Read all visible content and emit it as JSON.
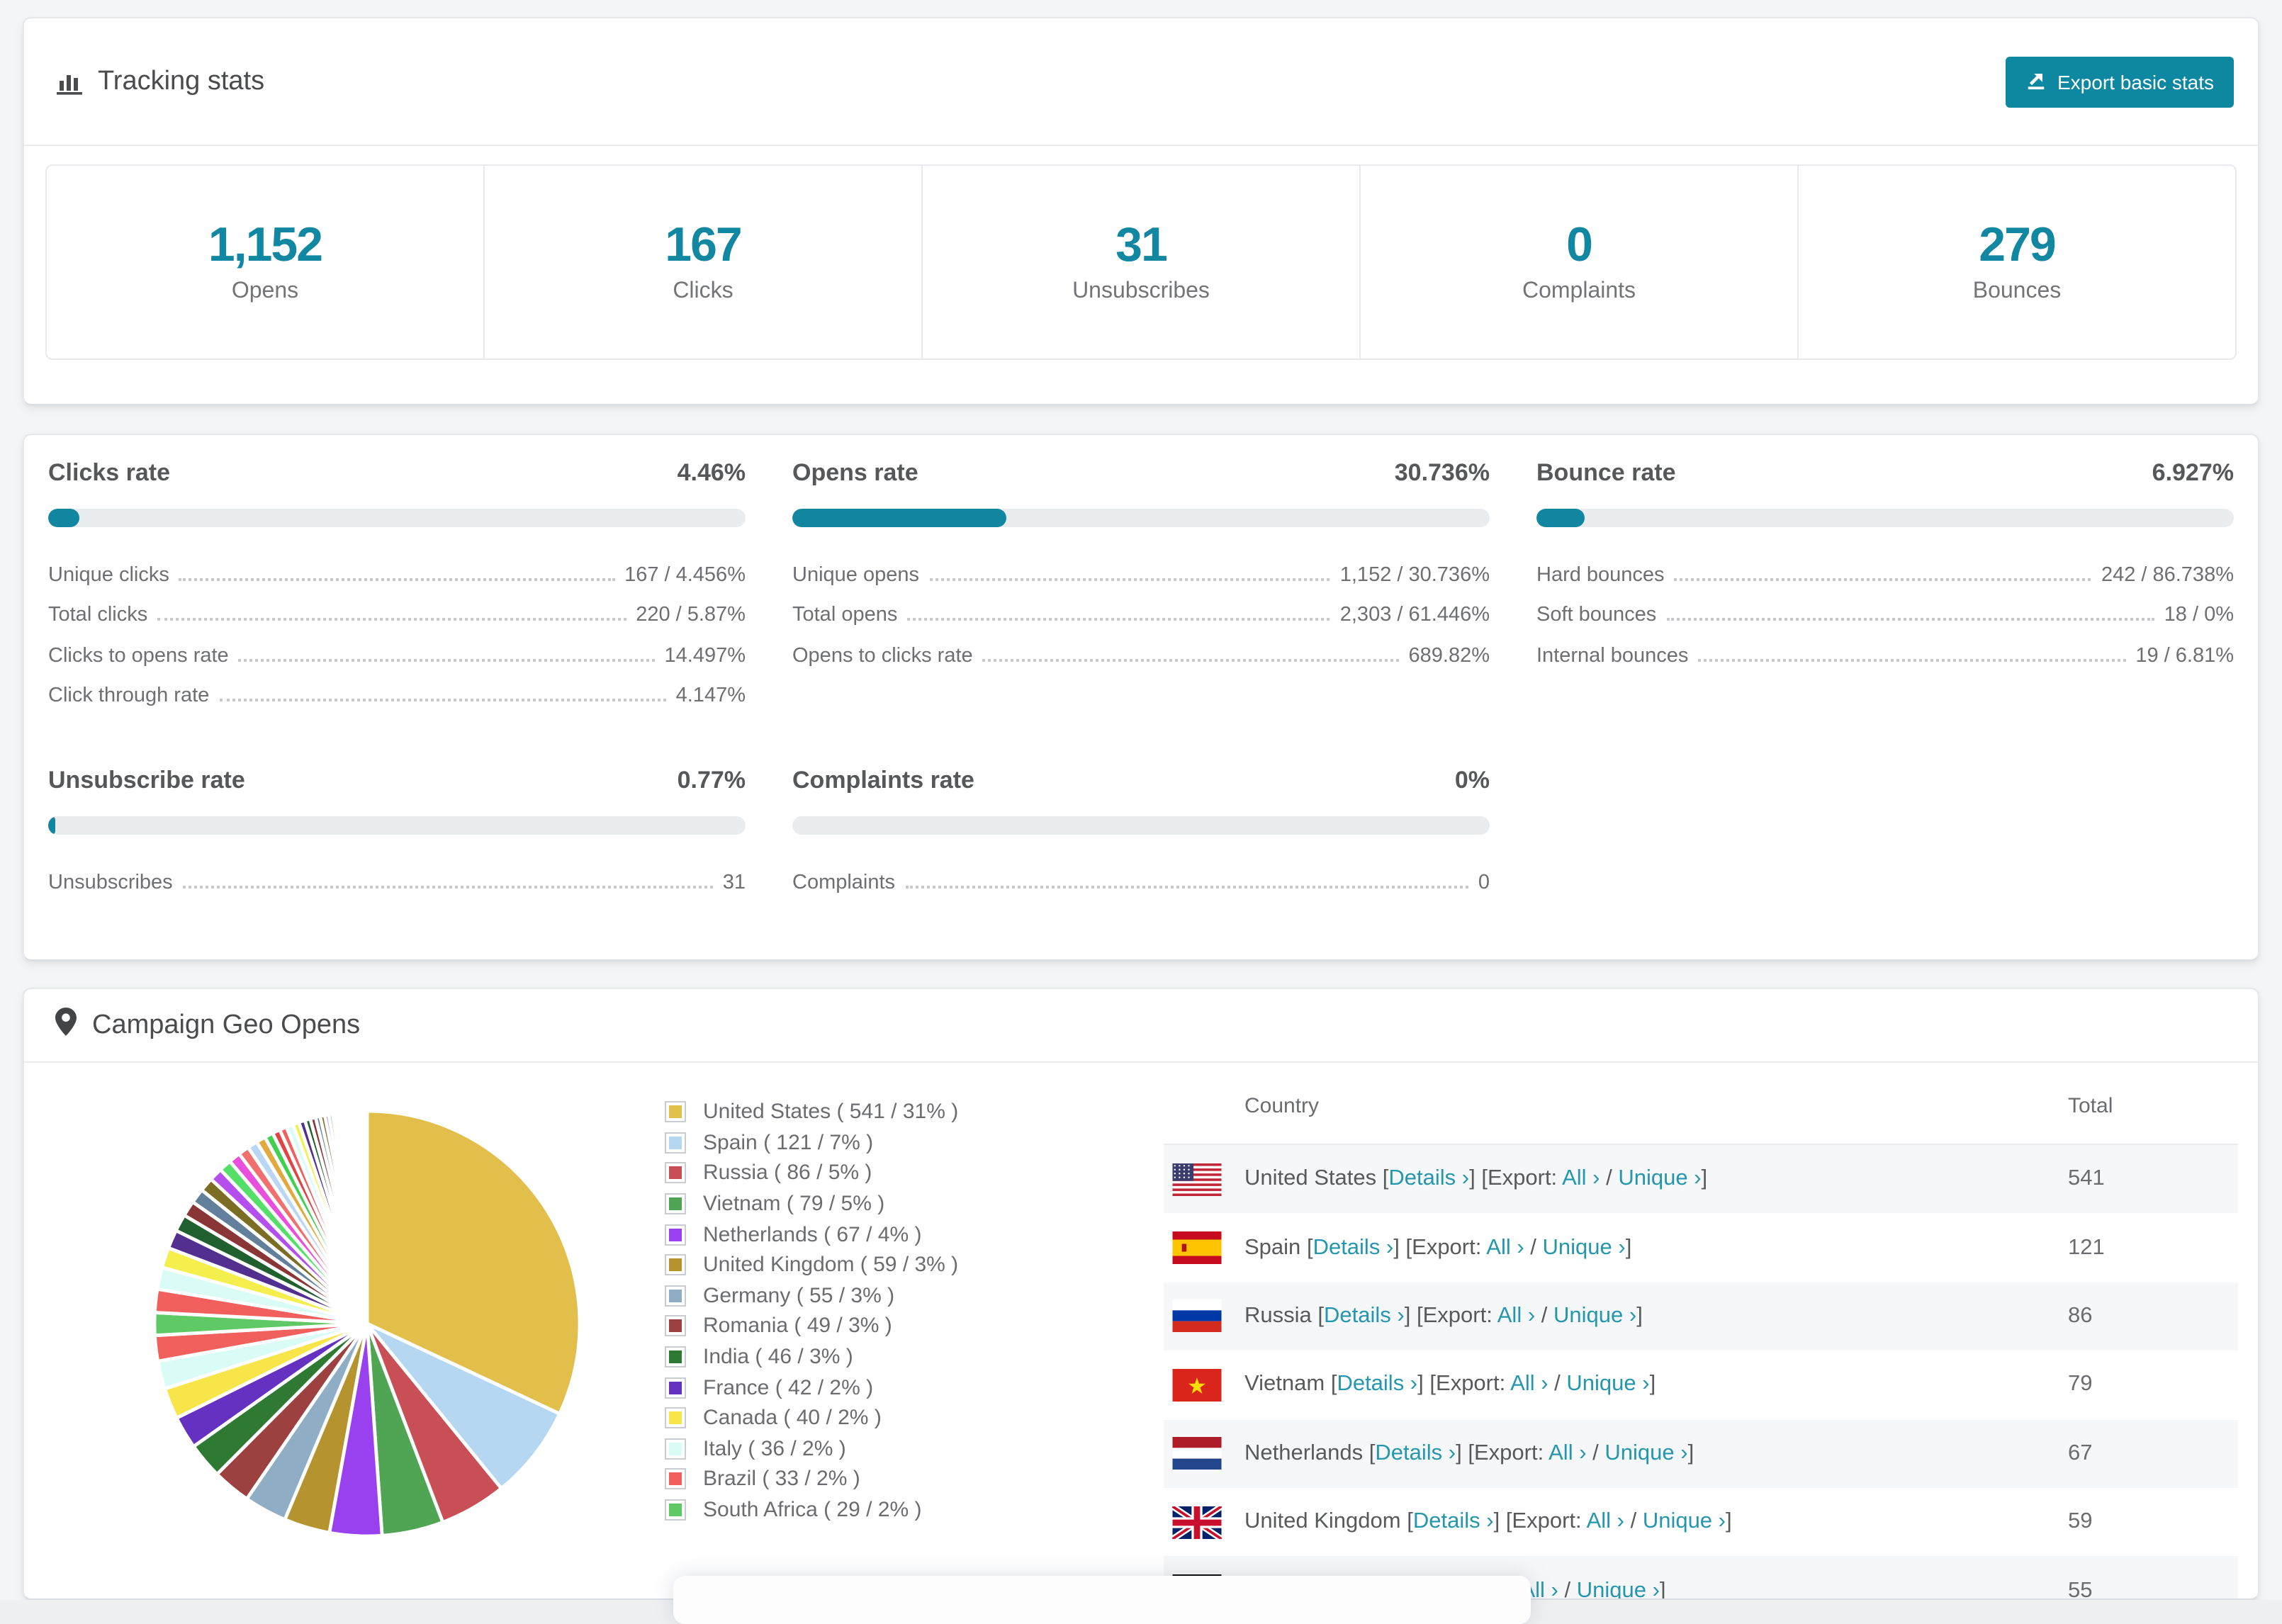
{
  "accent": {
    "teal": "#1186a0",
    "link": "#2496ae"
  },
  "tracking": {
    "title": "Tracking stats",
    "export_button": "Export basic stats",
    "stats": [
      {
        "value": "1,152",
        "label": "Opens"
      },
      {
        "value": "167",
        "label": "Clicks"
      },
      {
        "value": "31",
        "label": "Unsubscribes"
      },
      {
        "value": "0",
        "label": "Complaints"
      },
      {
        "value": "279",
        "label": "Bounces"
      }
    ]
  },
  "rates": [
    {
      "title": "Clicks rate",
      "value": "4.46%",
      "percent": 4.46,
      "rows": [
        {
          "label": "Unique clicks",
          "value": "167 / 4.456%"
        },
        {
          "label": "Total clicks",
          "value": "220 / 5.87%"
        },
        {
          "label": "Clicks to opens rate",
          "value": "14.497%"
        },
        {
          "label": "Click through rate",
          "value": "4.147%"
        }
      ]
    },
    {
      "title": "Opens rate",
      "value": "30.736%",
      "percent": 30.736,
      "rows": [
        {
          "label": "Unique opens",
          "value": "1,152 / 30.736%"
        },
        {
          "label": "Total opens",
          "value": "2,303 / 61.446%"
        },
        {
          "label": "Opens to clicks rate",
          "value": "689.82%"
        }
      ]
    },
    {
      "title": "Bounce rate",
      "value": "6.927%",
      "percent": 6.927,
      "rows": [
        {
          "label": "Hard bounces",
          "value": "242 / 86.738%"
        },
        {
          "label": "Soft bounces",
          "value": "18 / 0%"
        },
        {
          "label": "Internal bounces",
          "value": "19 / 6.81%"
        }
      ]
    },
    {
      "title": "Unsubscribe rate",
      "value": "0.77%",
      "percent": 0.77,
      "rows": [
        {
          "label": "Unsubscribes",
          "value": "31"
        }
      ]
    },
    {
      "title": "Complaints rate",
      "value": "0%",
      "percent": 0,
      "rows": [
        {
          "label": "Complaints",
          "value": "0"
        }
      ]
    }
  ],
  "geo": {
    "title": "Campaign Geo Opens",
    "table": {
      "columns": {
        "country": "Country",
        "total": "Total"
      },
      "link_details": "Details ›",
      "link_all": "All ›",
      "link_unique": "Unique ›",
      "bracket_open": "[",
      "bracket_close": "]",
      "export_prefix": "[Export:",
      "slash": "/",
      "rows": [
        {
          "country": "United States",
          "flag": "us",
          "total": "541"
        },
        {
          "country": "Spain",
          "flag": "es",
          "total": "121"
        },
        {
          "country": "Russia",
          "flag": "ru",
          "total": "86"
        },
        {
          "country": "Vietnam",
          "flag": "vn",
          "total": "79"
        },
        {
          "country": "Netherlands",
          "flag": "nl",
          "total": "67"
        },
        {
          "country": "United Kingdom",
          "flag": "gb",
          "total": "59"
        },
        {
          "country": "Germany",
          "flag": "de",
          "total": "55"
        }
      ]
    }
  },
  "chart_data": {
    "type": "pie",
    "title": "Campaign Geo Opens",
    "legend_position": "right-of-pie",
    "legend_format": "{label} ( {value} / {pct}% )",
    "slices": [
      {
        "label": "United States",
        "value": 541,
        "pct": 31,
        "color": "#e2be4b"
      },
      {
        "label": "Spain",
        "value": 121,
        "pct": 7,
        "color": "#b5d7f2"
      },
      {
        "label": "Russia",
        "value": 86,
        "pct": 5,
        "color": "#c84f55"
      },
      {
        "label": "Vietnam",
        "value": 79,
        "pct": 5,
        "color": "#4fa553"
      },
      {
        "label": "Netherlands",
        "value": 67,
        "pct": 4,
        "color": "#9a41ef"
      },
      {
        "label": "United Kingdom",
        "value": 59,
        "pct": 3,
        "color": "#b5942f"
      },
      {
        "label": "Germany",
        "value": 55,
        "pct": 3,
        "color": "#90adc6"
      },
      {
        "label": "Romania",
        "value": 49,
        "pct": 3,
        "color": "#9c4040"
      },
      {
        "label": "India",
        "value": 46,
        "pct": 3,
        "color": "#2f7a33"
      },
      {
        "label": "France",
        "value": 42,
        "pct": 2,
        "color": "#6531c1"
      },
      {
        "label": "Canada",
        "value": 40,
        "pct": 2,
        "color": "#f8e549"
      },
      {
        "label": "Italy",
        "value": 36,
        "pct": 2,
        "color": "#d9fcf6"
      },
      {
        "label": "Brazil",
        "value": 33,
        "pct": 2,
        "color": "#f2605e"
      },
      {
        "label": "South Africa",
        "value": 29,
        "pct": 2,
        "color": "#5fca65"
      }
    ],
    "others_values": [
      30,
      28,
      26,
      24,
      22,
      20,
      19,
      18,
      17,
      16,
      15,
      14,
      13,
      12,
      11,
      10,
      9,
      9,
      8,
      8,
      7,
      7,
      6,
      6,
      5,
      5,
      4,
      4,
      4,
      3,
      3,
      3,
      2,
      2,
      2,
      2,
      2,
      1,
      1,
      1,
      1,
      1,
      1,
      1,
      1,
      1,
      1,
      1,
      1,
      1
    ],
    "others_colors": [
      "#f2605e",
      "#d9fcf6",
      "#f5ef4e",
      "#53308f",
      "#20602f",
      "#8a3636",
      "#62809b",
      "#7c6d24",
      "#b44fee",
      "#55df69",
      "#e84fdc",
      "#f07070",
      "#b9d7f4",
      "#e2a93f",
      "#42d052",
      "#e04545"
    ]
  }
}
